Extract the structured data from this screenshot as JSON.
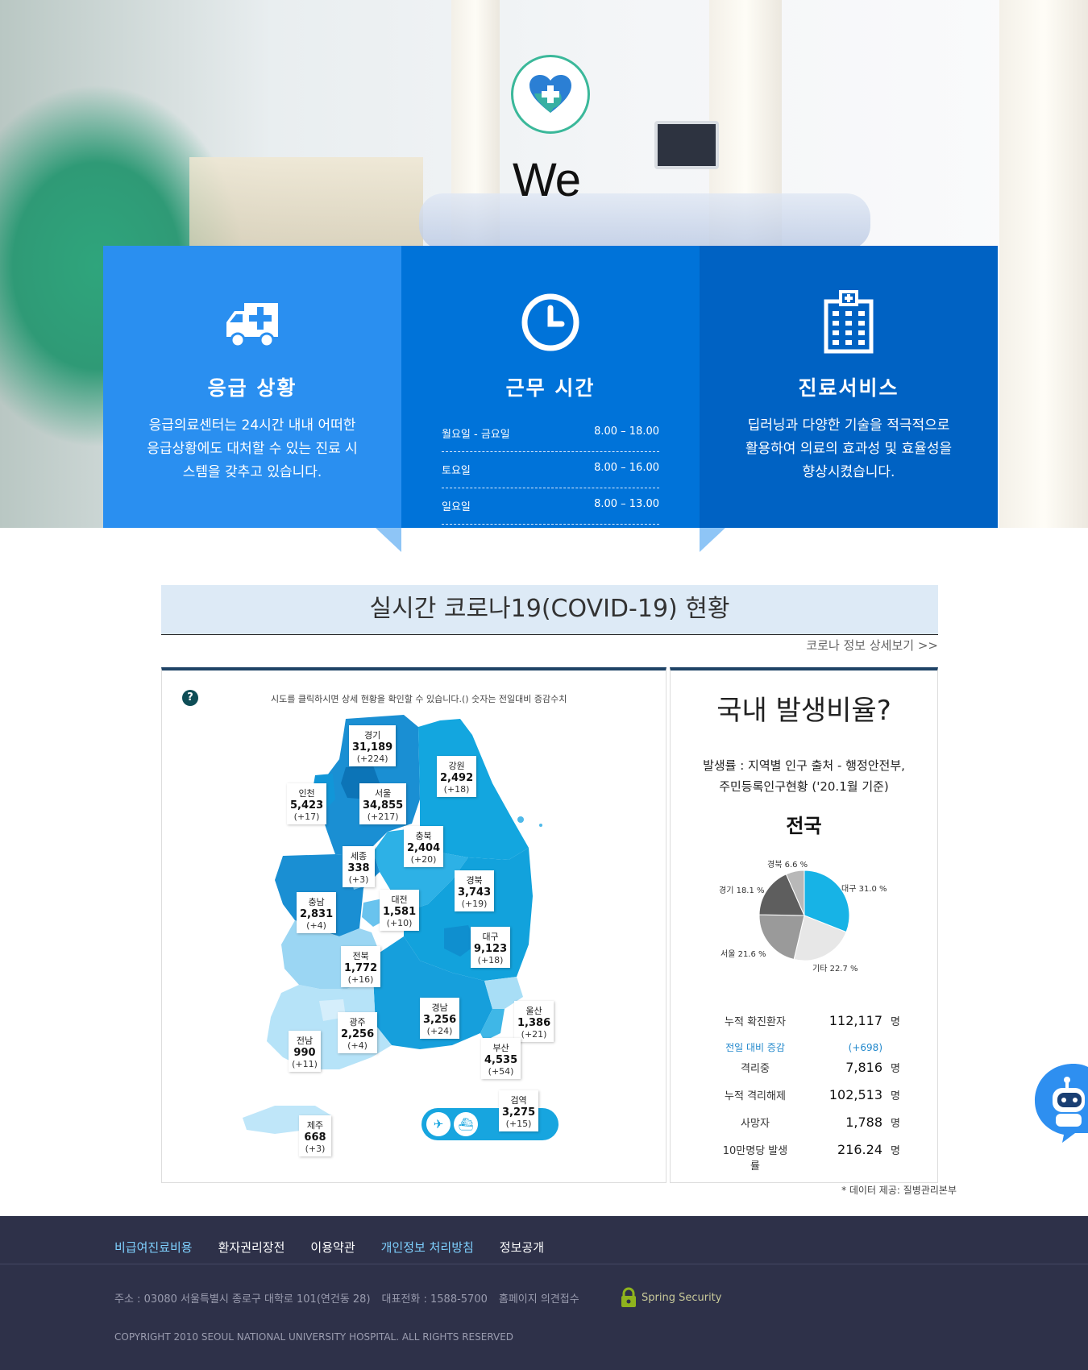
{
  "hero": {
    "heading": "We",
    "cards": [
      {
        "title": "응급 상황",
        "text": "응급의료센터는 24시간 내내 어떠한 응급상황에도 대처할 수 있는 진료 시스템을 갖추고 있습니다."
      },
      {
        "title": "근무 시간",
        "hours": [
          {
            "day": "월요일 - 금요일",
            "time": "8.00 – 18.00"
          },
          {
            "day": "토요일",
            "time": "8.00 – 16.00"
          },
          {
            "day": "일요일",
            "time": "8.00 – 13.00"
          }
        ]
      },
      {
        "title": "진료서비스",
        "text": "딥러닝과 다양한 기술을 적극적으로 활용하여 의료의 효과성 및 효율성을 향상시켰습니다."
      }
    ]
  },
  "covid": {
    "title": "실시간 코로나19(COVID-19) 현황",
    "more_link": "코로나 정보 상세보기 >>",
    "help": "?",
    "hint": "시도를 클릭하시면 상세 현황을 확인할 수 있습니다.() 숫자는 전일대비 증감수치",
    "regions": [
      {
        "name": "경기",
        "value": "31,189",
        "delta": "(+224)"
      },
      {
        "name": "강원",
        "value": "2,492",
        "delta": "(+18)"
      },
      {
        "name": "인천",
        "value": "5,423",
        "delta": "(+17)"
      },
      {
        "name": "서울",
        "value": "34,855",
        "delta": "(+217)"
      },
      {
        "name": "충북",
        "value": "2,404",
        "delta": "(+20)"
      },
      {
        "name": "세종",
        "value": "338",
        "delta": "(+3)"
      },
      {
        "name": "경북",
        "value": "3,743",
        "delta": "(+19)"
      },
      {
        "name": "충남",
        "value": "2,831",
        "delta": "(+4)"
      },
      {
        "name": "대전",
        "value": "1,581",
        "delta": "(+10)"
      },
      {
        "name": "대구",
        "value": "9,123",
        "delta": "(+18)"
      },
      {
        "name": "전북",
        "value": "1,772",
        "delta": "(+16)"
      },
      {
        "name": "경남",
        "value": "3,256",
        "delta": "(+24)"
      },
      {
        "name": "울산",
        "value": "1,386",
        "delta": "(+21)"
      },
      {
        "name": "광주",
        "value": "2,256",
        "delta": "(+4)"
      },
      {
        "name": "부산",
        "value": "4,535",
        "delta": "(+54)"
      },
      {
        "name": "전남",
        "value": "990",
        "delta": "(+11)"
      },
      {
        "name": "검역",
        "value": "3,275",
        "delta": "(+15)"
      },
      {
        "name": "제주",
        "value": "668",
        "delta": "(+3)"
      }
    ],
    "stats": {
      "title": "국내 발생비율?",
      "source_line1": "발생률 : 지역별 인구 출처 - 행정안전부,",
      "source_line2": "주민등록인구현황 ('20.1월 기준)",
      "nation": "전국",
      "pie_labels": {
        "gyeongbuk": "경북 6.6 %",
        "gyeonggi": "경기 18.1 %",
        "daegu": "대구 31.0 %",
        "seoul": "서울 21.6 %",
        "etc": "기타 22.7 %"
      },
      "rows": [
        {
          "label": "누적 확진환자",
          "value": "112,117",
          "unit": "명"
        },
        {
          "label": "전일 대비 증감",
          "value": "(+698)",
          "unit": ""
        },
        {
          "label": "격리중",
          "value": "7,816",
          "unit": "명"
        },
        {
          "label": "누적 격리해제",
          "value": "102,513",
          "unit": "명"
        },
        {
          "label": "사망자",
          "value": "1,788",
          "unit": "명"
        },
        {
          "label": "10만명당 발생률",
          "value": "216.24",
          "unit": "명"
        }
      ]
    },
    "data_note": "* 데이터 제공: 질병관리본부"
  },
  "chart_data": {
    "type": "pie",
    "title": "전국",
    "categories": [
      "대구",
      "기타",
      "서울",
      "경기",
      "경북"
    ],
    "values": [
      31.0,
      22.7,
      21.6,
      18.1,
      6.6
    ],
    "colors": [
      "#17b3e6",
      "#e7e7e7",
      "#9a9a9a",
      "#5e5e5e",
      "#b8b8b8"
    ]
  },
  "footer": {
    "nav": [
      "비급여진료비용",
      "환자권리장전",
      "이용약관",
      "개인정보 처리방침",
      "정보공개"
    ],
    "address": "주소 : 03080 서울특별시 종로구 대학로 101(연건동 28)",
    "phone": "대표전화 : 1588-5700",
    "feedback": "홈페이지 의견접수",
    "badge": "Spring Security",
    "copyright": "COPYRIGHT 2010 SEOUL NATIONAL UNIVERSITY HOSPITAL. ALL RIGHTS RESERVED"
  }
}
